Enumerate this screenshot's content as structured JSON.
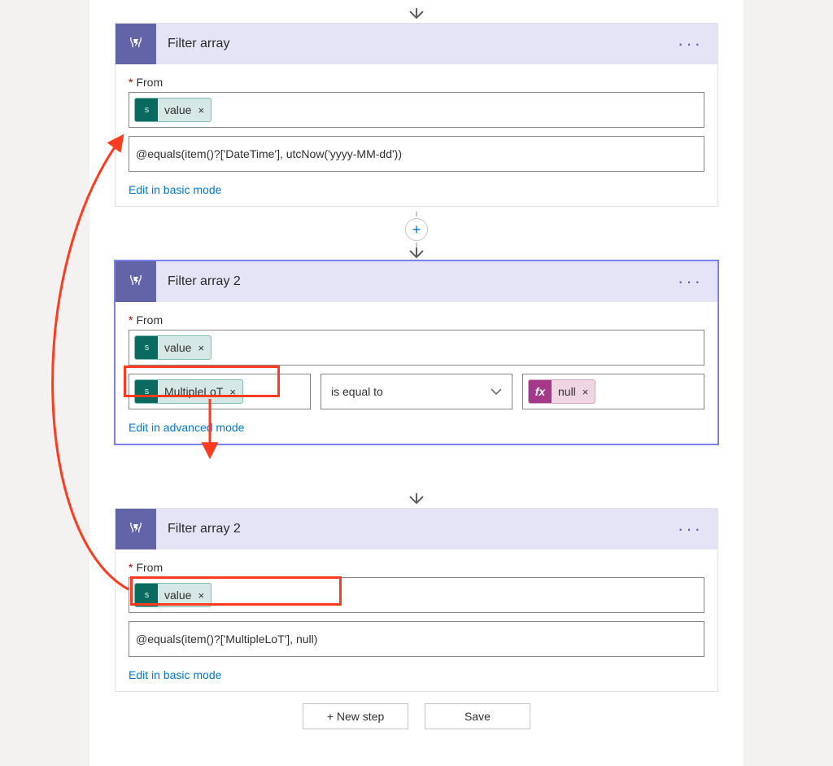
{
  "cards": [
    {
      "title": "Filter array",
      "from_label": "From",
      "token": "value",
      "expression": "@equals(item()?['DateTime'], utcNow('yyyy-MM-dd'))",
      "mode_link": "Edit in basic mode"
    },
    {
      "title": "Filter array 2",
      "from_label": "From",
      "token": "value",
      "cond_left_token": "MultipleLoT",
      "cond_op": "is equal to",
      "cond_right_token": "null",
      "mode_link": "Edit in advanced mode"
    },
    {
      "title": "Filter array 2",
      "from_label": "From",
      "token": "value",
      "expression": "@equals(item()?['MultipleLoT'], null)",
      "mode_link": "Edit in basic mode"
    }
  ],
  "buttons": {
    "new_step": "+ New step",
    "save": "Save"
  },
  "glyphs": {
    "required": "*",
    "remove": "×",
    "dots": "···",
    "add": "+",
    "fx": "fx"
  }
}
